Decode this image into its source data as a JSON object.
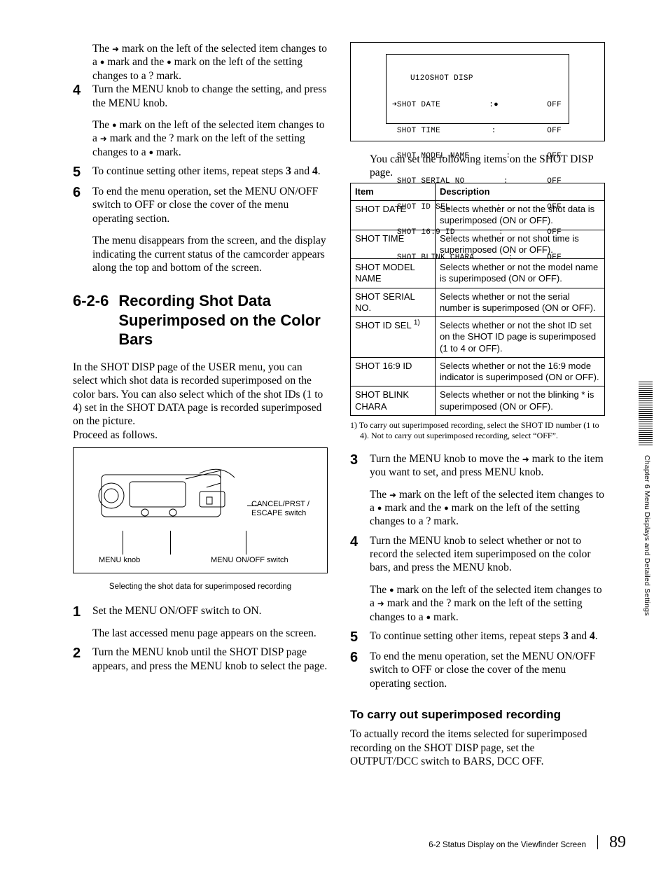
{
  "left": {
    "p1_a": "The ",
    "p1_b": " mark on the left of the selected item changes to a ",
    "p1_c": " mark and the ",
    "p1_d": " mark on the left of the setting changes to a ? mark.",
    "s4_num": "4",
    "s4": "Turn the MENU knob to change the setting, and press the MENU knob.",
    "s4_note_a": "The ",
    "s4_note_b": " mark on the left of the selected item changes to a ",
    "s4_note_c": " mark and the ? mark on the left of the setting changes to a ",
    "s4_note_d": " mark.",
    "s5_num": "5",
    "s5_a": "To continue setting other items, repeat steps ",
    "s5_b": "3",
    "s5_c": " and ",
    "s5_d": "4",
    "s5_e": ".",
    "s6_num": "6",
    "s6": "To end the menu operation, set the MENU ON/OFF switch to OFF or close the cover of the menu operating section.",
    "s6_note": "The menu disappears from the screen, and the display indicating the current status of the camcorder appears along the top and bottom of the  screen.",
    "sec_num": "6-2-6",
    "sec_title": "Recording Shot Data Superimposed on the Color Bars",
    "intro": "In the SHOT DISP page of the USER menu, you can select which shot data is recorded superimposed on the color bars.  You can also select which of the shot IDs (1 to 4) set in the SHOT DATA page is recorded superimposed on the picture.",
    "proceed": "Proceed as follows.",
    "fig_menu_knob": "MENU knob",
    "fig_onoff": "MENU ON/OFF switch",
    "fig_cancel": "CANCEL/PRST / ESCAPE switch",
    "fig_caption": "Selecting the shot data for superimposed recording",
    "s1_num": "1",
    "s1": "Set the MENU ON/OFF switch to ON.",
    "s1_note": "The last accessed menu page appears on the screen.",
    "s2_num": "2",
    "s2": "Turn the MENU knob until the SHOT DISP page appears, and press the MENU knob to select the page."
  },
  "right": {
    "screen_title": "U12OSHOT DISP",
    "screen_rows": [
      {
        "l": "➜SHOT DATE",
        "m": ":●",
        "r": "OFF"
      },
      {
        "l": " SHOT TIME",
        "m": ":",
        "r": "OFF"
      },
      {
        "l": " SHOT MODEL NAME",
        "m": ":",
        "r": "OFF"
      },
      {
        "l": " SHOT SERIAL NO",
        "m": ":",
        "r": "OFF"
      },
      {
        "l": " SHOT ID SEL",
        "m": ":",
        "r": "OFF"
      },
      {
        "l": " SHOT 16:9 ID",
        "m": ":",
        "r": "OFF"
      },
      {
        "l": " SHOT BLINK CHARA",
        "m": ":",
        "r": "OFF"
      }
    ],
    "after_screen": "You can set the following items on the SHOT DISP page.",
    "th_item": "Item",
    "th_desc": "Description",
    "table": [
      {
        "item": "SHOT DATE",
        "desc": "Selects whether or not the shot data is superimposed (ON or OFF)."
      },
      {
        "item": "SHOT TIME",
        "desc": "Selects whether or not shot time is superimposed (ON or OFF)."
      },
      {
        "item": "SHOT MODEL NAME",
        "desc": "Selects whether or not the model name is superimposed (ON or OFF)."
      },
      {
        "item": "SHOT SERIAL NO.",
        "desc": "Selects whether or not the serial number is superimposed (ON or OFF)."
      },
      {
        "item": "SHOT ID SEL ",
        "sup": "1)",
        "desc": "Selects whether or not the shot ID set on the SHOT ID page is superimposed (1 to 4 or OFF)."
      },
      {
        "item": "SHOT 16:9 ID",
        "desc": "Selects whether or not the 16:9 mode indicator is superimposed (ON or OFF)."
      },
      {
        "item": "SHOT BLINK CHARA",
        "desc": "Selects whether or not the blinking * is superimposed (ON or OFF)."
      }
    ],
    "footnote": "1) To carry out superimposed recording, select the SHOT ID number (1 to 4). Not to carry out superimposed recording, select “OFF”.",
    "s3_num": "3",
    "s3_a": "Turn the MENU knob to move the ",
    "s3_b": " mark to the item you want to set, and press MENU knob.",
    "s3_note_a": "The ",
    "s3_note_b": " mark on the left of the selected item changes to a ",
    "s3_note_c": " mark and the ",
    "s3_note_d": " mark on the left of the setting changes to a ? mark.",
    "s4_num": "4",
    "s4": "Turn the MENU knob to select whether or not to record the selected item superimposed on the color bars, and press the MENU knob.",
    "s4_note_a": "The ",
    "s4_note_b": " mark on the left of the selected item changes to a ",
    "s4_note_c": " mark and the ? mark on the left of the setting changes to a ",
    "s4_note_d": " mark.",
    "s5_num": "5",
    "s5_a": "To continue setting other items, repeat steps ",
    "s5_b": "3",
    "s5_c": " and ",
    "s5_d": "4",
    "s5_e": ".",
    "s6_num": "6",
    "s6": "To end the menu operation, set the MENU ON/OFF switch to OFF or close the cover of the menu operating section.",
    "sub_heading": "To carry out superimposed recording",
    "sub_body": "To actually record the items selected for superimposed recording on the SHOT DISP page, set the OUTPUT/DCC switch to BARS, DCC OFF."
  },
  "margin": {
    "side": "Chapter 6   Menu Displays and Detailed Settings"
  },
  "footer": {
    "section": "6-2 Status Display on the Viewfinder Screen",
    "page": "89"
  }
}
